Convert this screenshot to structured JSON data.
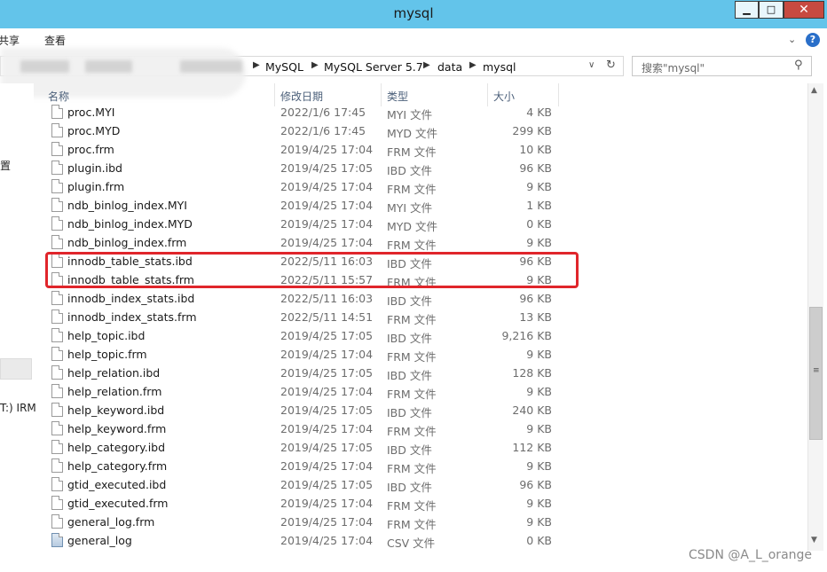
{
  "window": {
    "title": "mysql"
  },
  "title_buttons": {
    "minimize": "▁",
    "maximize": "□",
    "close": "✕"
  },
  "ribbon": {
    "tab_share": "共享",
    "tab_view": "查看",
    "help": "?"
  },
  "address": {
    "crumbs": [
      "MySQL",
      "MySQL Server 5.7",
      "data",
      "mysql"
    ]
  },
  "search": {
    "placeholder": "搜索\"mysql\""
  },
  "nav": {
    "text_1": "置",
    "text_2": "T:) IRM"
  },
  "columns": {
    "name": "名称",
    "date": "修改日期",
    "type": "类型",
    "size": "大小"
  },
  "files": [
    {
      "name": "proc.MYI",
      "date": "2022/1/6 17:45",
      "type": "MYI 文件",
      "size": "4 KB"
    },
    {
      "name": "proc.MYD",
      "date": "2022/1/6 17:45",
      "type": "MYD 文件",
      "size": "299 KB"
    },
    {
      "name": "proc.frm",
      "date": "2019/4/25 17:04",
      "type": "FRM 文件",
      "size": "10 KB"
    },
    {
      "name": "plugin.ibd",
      "date": "2019/4/25 17:05",
      "type": "IBD 文件",
      "size": "96 KB"
    },
    {
      "name": "plugin.frm",
      "date": "2019/4/25 17:04",
      "type": "FRM 文件",
      "size": "9 KB"
    },
    {
      "name": "ndb_binlog_index.MYI",
      "date": "2019/4/25 17:04",
      "type": "MYI 文件",
      "size": "1 KB"
    },
    {
      "name": "ndb_binlog_index.MYD",
      "date": "2019/4/25 17:04",
      "type": "MYD 文件",
      "size": "0 KB"
    },
    {
      "name": "ndb_binlog_index.frm",
      "date": "2019/4/25 17:04",
      "type": "FRM 文件",
      "size": "9 KB"
    },
    {
      "name": "innodb_table_stats.ibd",
      "date": "2022/5/11 16:03",
      "type": "IBD 文件",
      "size": "96 KB"
    },
    {
      "name": "innodb_table_stats.frm",
      "date": "2022/5/11 15:57",
      "type": "FRM 文件",
      "size": "9 KB"
    },
    {
      "name": "innodb_index_stats.ibd",
      "date": "2022/5/11 16:03",
      "type": "IBD 文件",
      "size": "96 KB"
    },
    {
      "name": "innodb_index_stats.frm",
      "date": "2022/5/11 14:51",
      "type": "FRM 文件",
      "size": "13 KB"
    },
    {
      "name": "help_topic.ibd",
      "date": "2019/4/25 17:05",
      "type": "IBD 文件",
      "size": "9,216 KB"
    },
    {
      "name": "help_topic.frm",
      "date": "2019/4/25 17:04",
      "type": "FRM 文件",
      "size": "9 KB"
    },
    {
      "name": "help_relation.ibd",
      "date": "2019/4/25 17:05",
      "type": "IBD 文件",
      "size": "128 KB"
    },
    {
      "name": "help_relation.frm",
      "date": "2019/4/25 17:04",
      "type": "FRM 文件",
      "size": "9 KB"
    },
    {
      "name": "help_keyword.ibd",
      "date": "2019/4/25 17:05",
      "type": "IBD 文件",
      "size": "240 KB"
    },
    {
      "name": "help_keyword.frm",
      "date": "2019/4/25 17:04",
      "type": "FRM 文件",
      "size": "9 KB"
    },
    {
      "name": "help_category.ibd",
      "date": "2019/4/25 17:05",
      "type": "IBD 文件",
      "size": "112 KB"
    },
    {
      "name": "help_category.frm",
      "date": "2019/4/25 17:04",
      "type": "FRM 文件",
      "size": "9 KB"
    },
    {
      "name": "gtid_executed.ibd",
      "date": "2019/4/25 17:05",
      "type": "IBD 文件",
      "size": "96 KB"
    },
    {
      "name": "gtid_executed.frm",
      "date": "2019/4/25 17:04",
      "type": "FRM 文件",
      "size": "9 KB"
    },
    {
      "name": "general_log.frm",
      "date": "2019/4/25 17:04",
      "type": "FRM 文件",
      "size": "9 KB"
    },
    {
      "name": "general_log",
      "date": "2019/4/25 17:04",
      "type": "CSV 文件",
      "size": "0 KB"
    }
  ],
  "icons": {
    "file": "file-icon",
    "csv": "csv-file-icon"
  },
  "colors": {
    "titlebar": "#63c4ea",
    "close": "#c74a40",
    "highlight": "#e0252b"
  },
  "watermark": "CSDN @A_L_orange"
}
